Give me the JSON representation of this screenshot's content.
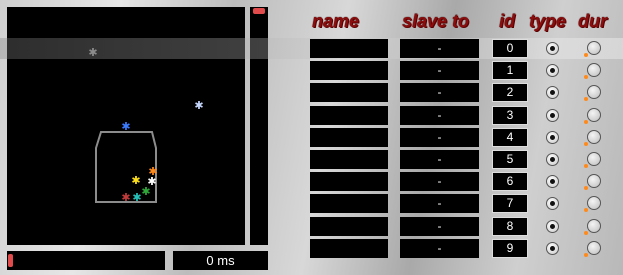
{
  "header": {
    "name": "name",
    "slave_to": "slave to",
    "id": "id",
    "type": "type",
    "dur": "dur"
  },
  "time_display": "0 ms",
  "rows": [
    {
      "name": "",
      "slave": "-",
      "id": "0",
      "selected": true
    },
    {
      "name": "",
      "slave": "-",
      "id": "1"
    },
    {
      "name": "",
      "slave": "-",
      "id": "2"
    },
    {
      "name": "",
      "slave": "-",
      "id": "3"
    },
    {
      "name": "",
      "slave": "-",
      "id": "4"
    },
    {
      "name": "",
      "slave": "-",
      "id": "5"
    },
    {
      "name": "",
      "slave": "-",
      "id": "6"
    },
    {
      "name": "",
      "slave": "-",
      "id": "7"
    },
    {
      "name": "",
      "slave": "-",
      "id": "8"
    },
    {
      "name": "",
      "slave": "-",
      "id": "9"
    }
  ],
  "colors": {
    "accent": "#e24b4b",
    "header_text": "#8b0d0d",
    "duration_marker": "#ff8a1c"
  },
  "canvas_markers": [
    {
      "name": "gray-marker",
      "color": "#888888"
    },
    {
      "name": "light-blue-marker",
      "color": "#c7d8ff"
    },
    {
      "name": "blue-marker",
      "color": "#3b7bff"
    },
    {
      "name": "orange-marker",
      "color": "#ff8a1c"
    },
    {
      "name": "yellow-marker",
      "color": "#ffe01a"
    },
    {
      "name": "white-marker",
      "color": "#ffffff"
    },
    {
      "name": "green-marker",
      "color": "#2fa83a"
    },
    {
      "name": "red-marker",
      "color": "#c23b3b"
    },
    {
      "name": "teal-marker",
      "color": "#25c0b8"
    }
  ]
}
